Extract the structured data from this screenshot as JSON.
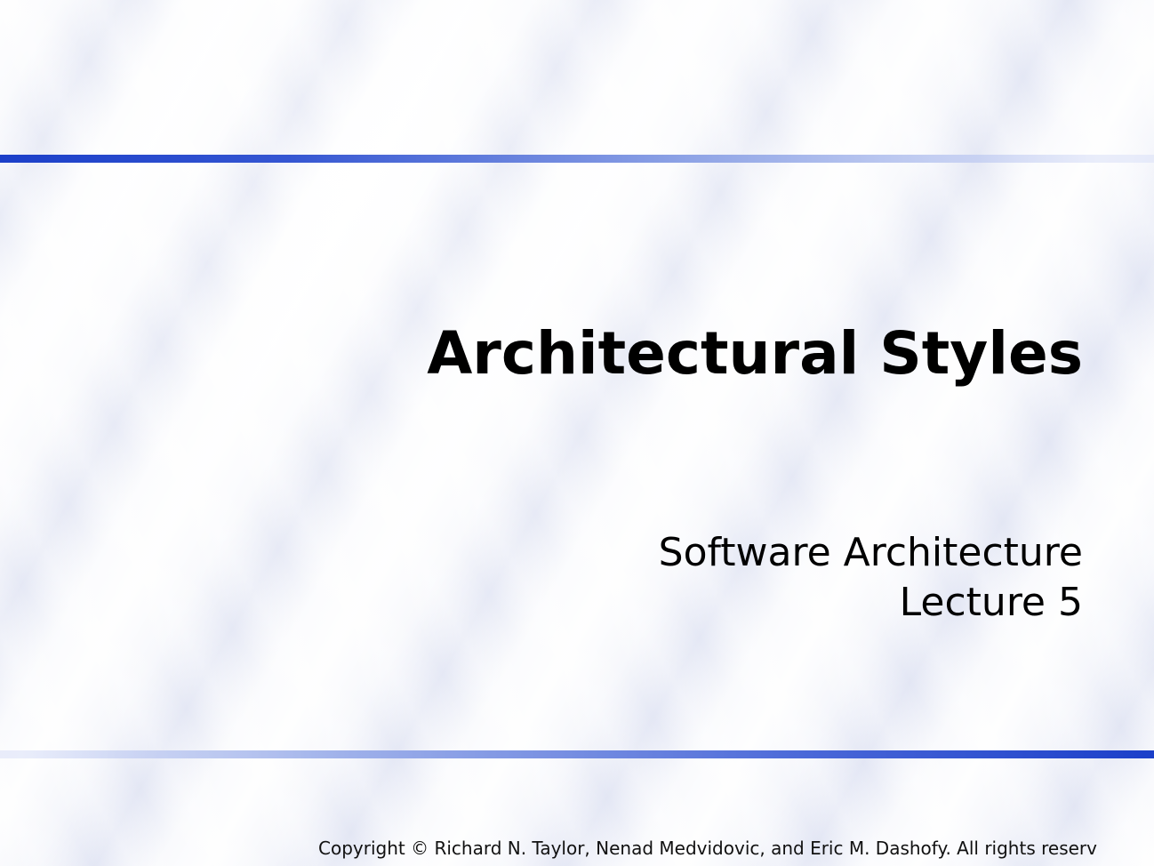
{
  "slide": {
    "title": "Architectural Styles",
    "subtitle_line1": "Software Architecture",
    "subtitle_line2": "Lecture 5",
    "copyright": "Copyright © Richard N. Taylor, Nenad Medvidovic, and Eric M. Dashofy. All rights reserv"
  },
  "colors": {
    "rule_blue": "#1b3fc9",
    "background": "#eef0f8",
    "text": "#000000"
  }
}
